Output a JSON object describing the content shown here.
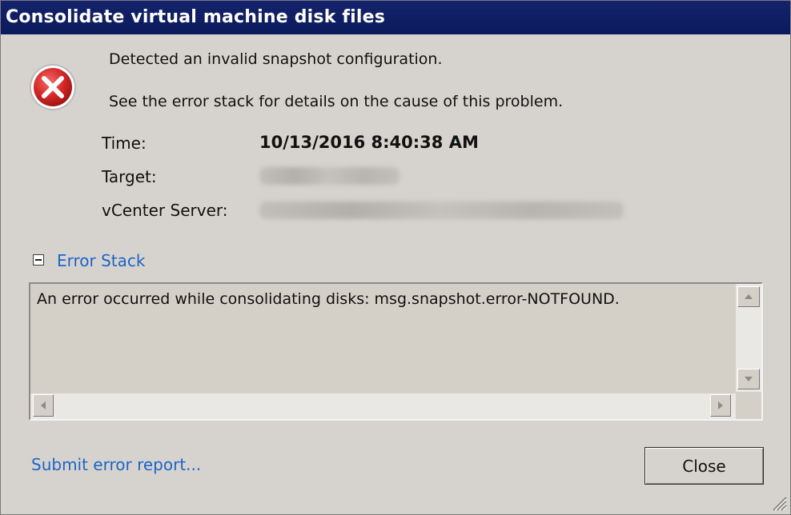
{
  "window": {
    "title": "Consolidate virtual machine disk files"
  },
  "message": {
    "line1": "Detected an invalid snapshot configuration.",
    "line2": "See the error stack for details on the cause of this problem."
  },
  "details": {
    "time_label": "Time:",
    "time_value": "10/13/2016 8:40:38 AM",
    "target_label": "Target:",
    "vcenter_label": "vCenter Server:"
  },
  "error_stack": {
    "toggle_label": "Error Stack",
    "text": "An error occurred while consolidating disks: msg.snapshot.error-NOTFOUND."
  },
  "footer": {
    "submit_link": "Submit error report...",
    "close_label": "Close"
  },
  "icons": {
    "status": "error-icon",
    "toggle": "collapse-minus-icon",
    "grip": "resize-grip-icon"
  },
  "colors": {
    "titlebar": "#0b1a5c",
    "link": "#1e64c8",
    "error_red": "#d62828"
  }
}
